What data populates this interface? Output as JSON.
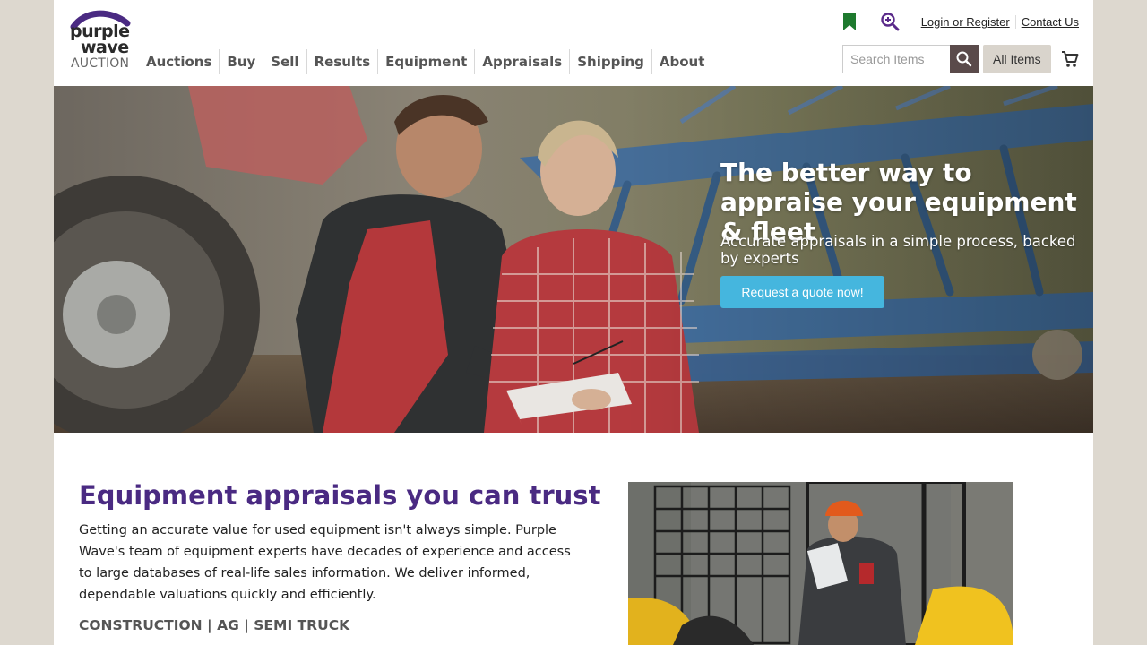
{
  "logo": {
    "line1": "purple",
    "line2": "wave",
    "line3": "AUCTION",
    "brand_color": "#4a2a82"
  },
  "nav": {
    "items": [
      {
        "label": "Auctions"
      },
      {
        "label": "Buy"
      },
      {
        "label": "Sell"
      },
      {
        "label": "Results"
      },
      {
        "label": "Equipment"
      },
      {
        "label": "Appraisals"
      },
      {
        "label": "Shipping"
      },
      {
        "label": "About"
      }
    ]
  },
  "utility": {
    "bookmark_icon": "bookmark-icon",
    "zoom_icon": "zoom-in-icon",
    "login_label": "Login or Register",
    "contact_label": "Contact Us"
  },
  "search": {
    "placeholder": "Search Items",
    "value": "",
    "button_icon": "search-icon",
    "scope_label": "All Items",
    "cart_icon": "cart-icon"
  },
  "hero": {
    "title": "The better way to appraise your equipment & fleet",
    "subtitle": "Accurate appraisals in a simple process, backed by experts",
    "cta_label": "Request a quote now!",
    "cta_color": "#45b6de"
  },
  "content": {
    "title": "Equipment appraisals you can trust",
    "body": "Getting an accurate value for used equipment isn't always simple. Purple Wave's team of equipment experts have decades of experience and access to large databases of real-life sales information. We deliver informed, dependable valuations quickly and efficiently.",
    "categories": "CONSTRUCTION | AG | SEMI TRUCK"
  }
}
